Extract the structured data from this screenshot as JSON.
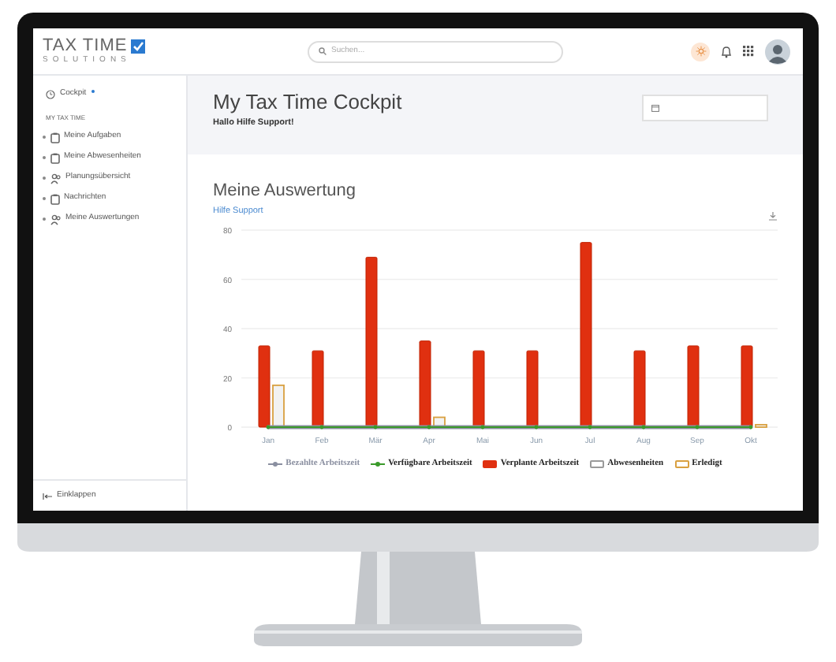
{
  "header": {
    "logo": {
      "line_1": "TAX TIME",
      "line_2": "SOLUTIONS"
    },
    "search": {
      "placeholder": "Suchen..."
    }
  },
  "sidebar": {
    "top_item": {
      "label": "Cockpit",
      "badge": true
    },
    "section": "MY TAX TIME",
    "items": [
      {
        "label": "Meine Aufgaben",
        "kind": "clipboard"
      },
      {
        "label": "Meine Abwesenheiten",
        "kind": "clipboard"
      },
      {
        "label": "Planungsübersicht",
        "kind": "people"
      },
      {
        "label": "Nachrichten",
        "kind": "clipboard"
      },
      {
        "label": "Meine Auswertungen",
        "kind": "people"
      }
    ],
    "collapse": "Einklappen"
  },
  "page_header": {
    "title": "My Tax Time Cockpit",
    "greeting": "Hallo Hilfe Support!"
  },
  "card": {
    "title": "Meine Auswertung",
    "subtitle": "Hilfe Support",
    "chart_data": {
      "type": "bar",
      "categories": [
        "Jan",
        "Feb",
        "Mär",
        "Apr",
        "Mai",
        "Jun",
        "Jul",
        "Aug",
        "Sep",
        "Okt"
      ],
      "ylim": [
        0,
        80
      ],
      "grid": true,
      "yticks": [
        0,
        20,
        40,
        60,
        80
      ],
      "series": [
        {
          "name": "Bezahlte Arbeitszeit",
          "color": "#8a8fa0",
          "type": "line",
          "values": [
            0,
            0,
            0,
            0,
            0,
            0,
            0,
            0,
            0,
            0
          ]
        },
        {
          "name": "Verfügbare Arbeitszeit",
          "color": "#3a9a2a",
          "type": "line",
          "values": [
            0,
            0,
            0,
            0,
            0,
            0,
            0,
            0,
            0,
            0
          ]
        },
        {
          "name": "Verplante Arbeitszeit",
          "color": "#e03010",
          "type": "bar",
          "values": [
            33,
            31,
            69,
            35,
            31,
            31,
            75,
            31,
            33,
            33
          ]
        },
        {
          "name": "Abwesenheiten",
          "color": "#9a9a9a",
          "type": "bar",
          "values": [
            0,
            0,
            0,
            0,
            0,
            0,
            0,
            0,
            0,
            0
          ]
        },
        {
          "name": "Erledigt",
          "color": "#d9a040",
          "type": "bar",
          "values": [
            17,
            0,
            0,
            4,
            0,
            0,
            0,
            0,
            0,
            1
          ]
        }
      ]
    }
  }
}
